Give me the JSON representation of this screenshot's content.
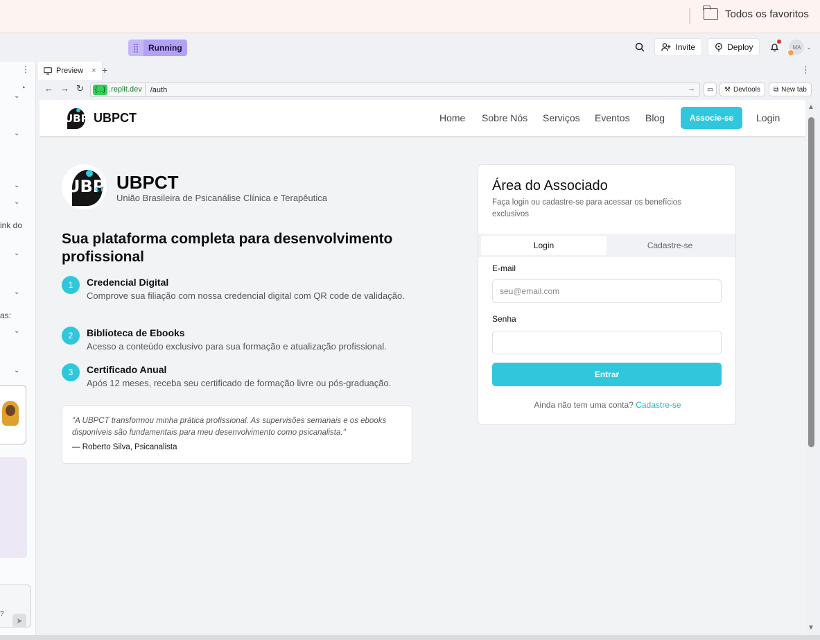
{
  "browser": {
    "bookmark_folder": "Todos os favoritos",
    "folder_icon": "folder-icon"
  },
  "replit": {
    "status": "Running",
    "invite": "Invite",
    "deploy": "Deploy",
    "avatar_initials": "MA",
    "preview_tab": "Preview",
    "url_domain": ".replit.dev",
    "url_badge": "{...}",
    "url_path": "/auth",
    "devtools": "Devtools",
    "new_tab": "New tab"
  },
  "left_pane": {
    "snippet1": "ink do",
    "snippet2": "as:",
    "snippet3": "?"
  },
  "site": {
    "brand": "UBPCT",
    "logo_text": "UBP",
    "logo_suffix": "CT",
    "nav": [
      "Home",
      "Sobre Nós",
      "Serviços",
      "Eventos",
      "Blog"
    ],
    "cta": "Associe-se",
    "login": "Login"
  },
  "hero": {
    "title": "UBPCT",
    "subtitle": "União Brasileira de Psicanálise Clínica e Terapêutica",
    "headline": "Sua plataforma completa para desenvolvimento profissional",
    "features": [
      {
        "num": "1",
        "title": "Credencial Digital",
        "desc": "Comprove sua filiação com nossa credencial digital com QR code de validação."
      },
      {
        "num": "2",
        "title": "Biblioteca de Ebooks",
        "desc": "Acesso a conteúdo exclusivo para sua formação e atualização profissional."
      },
      {
        "num": "3",
        "title": "Certificado Anual",
        "desc": "Após 12 meses, receba seu certificado de formação livre ou pós-graduação."
      }
    ],
    "quote": "\"A UBPCT transformou minha prática profissional. As supervisões semanais e os ebooks disponíveis são fundamentais para meu desenvolvimento como psicanalista.\"",
    "quote_author": "— Roberto Silva, Psicanalista"
  },
  "auth": {
    "title": "Área do Associado",
    "subtitle": "Faça login ou cadastre-se para acessar os benefícios exclusivos",
    "tab_login": "Login",
    "tab_signup": "Cadastre-se",
    "email_label": "E-mail",
    "email_placeholder": "seu@email.com",
    "password_label": "Senha",
    "submit": "Entrar",
    "signup_prompt": "Ainda não tem uma conta?",
    "signup_link": "Cadastre-se"
  }
}
